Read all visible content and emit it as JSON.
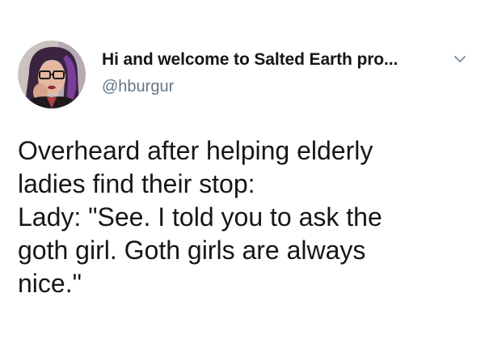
{
  "tweet": {
    "author": {
      "display_name": "Hi and welcome to Salted Earth pro...",
      "handle": "@hburgur"
    },
    "text_lines": [
      "Overheard after helping elderly",
      "ladies find their stop:",
      "Lady: \"See. I told you to ask the",
      "goth girl. Goth girls are always",
      "nice.\""
    ],
    "icons": {
      "menu": "chevron-down-icon",
      "avatar": "avatar"
    }
  },
  "colors": {
    "text_primary": "#14171a",
    "text_secondary": "#657786",
    "chevron": "#8899a6",
    "background": "#ffffff"
  }
}
